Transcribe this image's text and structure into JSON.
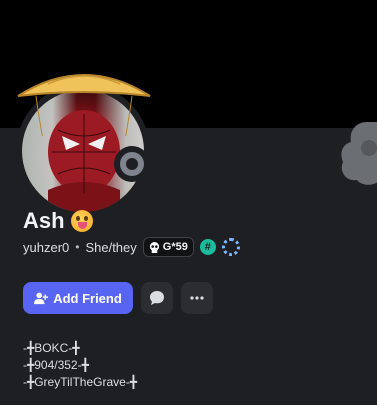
{
  "profile": {
    "display_name": "Ash",
    "username": "yuhzer0",
    "separator": "•",
    "pronouns": "She/they",
    "tag": "G*59",
    "badge_hash": "#",
    "status": "idle"
  },
  "actions": {
    "add_friend_label": "Add Friend"
  },
  "bio": {
    "lines": [
      "-╋BOKC-╋",
      "-╋904/352-╋",
      "-╋GreyTilTheGrave-╋"
    ]
  },
  "colors": {
    "banner": "#000000",
    "background": "#1e1f22",
    "accent": "#5865f2",
    "status_idle": "#80848e",
    "badge_teal": "#1abc9c"
  },
  "icons": {
    "status": "status-idle-icon",
    "tag_icon": "skull-icon",
    "add_friend": "add-user-icon",
    "message": "chat-bubble-icon",
    "more": "more-dots-icon",
    "cloud": "cloud-decoration-icon"
  }
}
